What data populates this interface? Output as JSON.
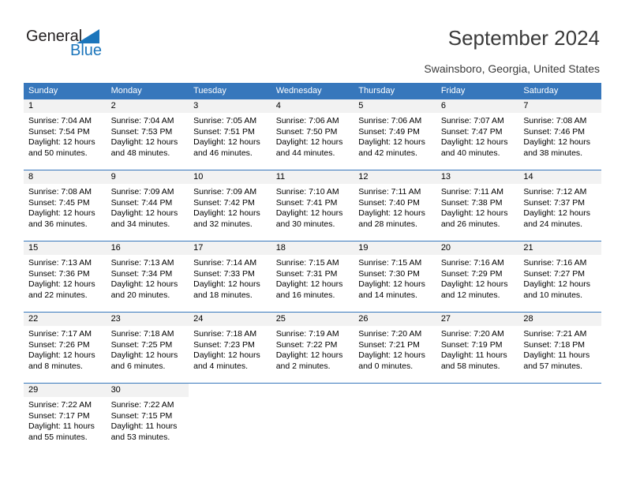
{
  "logo": {
    "text_top": "General",
    "text_bottom": "Blue",
    "triangle_color": "#1b75bb",
    "text_top_color": "#231f20",
    "text_bottom_color": "#1b75bb"
  },
  "header": {
    "title": "September 2024",
    "subtitle": "Swainsboro, Georgia, United States"
  },
  "theme": {
    "header_blue": "#3777bc",
    "day_band_gray": "#f2f2f2",
    "cell_white": "#ffffff",
    "text_dark": "#000000"
  },
  "calendar": {
    "weekday_headers": [
      "Sunday",
      "Monday",
      "Tuesday",
      "Wednesday",
      "Thursday",
      "Friday",
      "Saturday"
    ],
    "weeks": [
      [
        {
          "day": "1",
          "sunrise": "Sunrise: 7:04 AM",
          "sunset": "Sunset: 7:54 PM",
          "daylight_line1": "Daylight: 12 hours",
          "daylight_line2": "and 50 minutes."
        },
        {
          "day": "2",
          "sunrise": "Sunrise: 7:04 AM",
          "sunset": "Sunset: 7:53 PM",
          "daylight_line1": "Daylight: 12 hours",
          "daylight_line2": "and 48 minutes."
        },
        {
          "day": "3",
          "sunrise": "Sunrise: 7:05 AM",
          "sunset": "Sunset: 7:51 PM",
          "daylight_line1": "Daylight: 12 hours",
          "daylight_line2": "and 46 minutes."
        },
        {
          "day": "4",
          "sunrise": "Sunrise: 7:06 AM",
          "sunset": "Sunset: 7:50 PM",
          "daylight_line1": "Daylight: 12 hours",
          "daylight_line2": "and 44 minutes."
        },
        {
          "day": "5",
          "sunrise": "Sunrise: 7:06 AM",
          "sunset": "Sunset: 7:49 PM",
          "daylight_line1": "Daylight: 12 hours",
          "daylight_line2": "and 42 minutes."
        },
        {
          "day": "6",
          "sunrise": "Sunrise: 7:07 AM",
          "sunset": "Sunset: 7:47 PM",
          "daylight_line1": "Daylight: 12 hours",
          "daylight_line2": "and 40 minutes."
        },
        {
          "day": "7",
          "sunrise": "Sunrise: 7:08 AM",
          "sunset": "Sunset: 7:46 PM",
          "daylight_line1": "Daylight: 12 hours",
          "daylight_line2": "and 38 minutes."
        }
      ],
      [
        {
          "day": "8",
          "sunrise": "Sunrise: 7:08 AM",
          "sunset": "Sunset: 7:45 PM",
          "daylight_line1": "Daylight: 12 hours",
          "daylight_line2": "and 36 minutes."
        },
        {
          "day": "9",
          "sunrise": "Sunrise: 7:09 AM",
          "sunset": "Sunset: 7:44 PM",
          "daylight_line1": "Daylight: 12 hours",
          "daylight_line2": "and 34 minutes."
        },
        {
          "day": "10",
          "sunrise": "Sunrise: 7:09 AM",
          "sunset": "Sunset: 7:42 PM",
          "daylight_line1": "Daylight: 12 hours",
          "daylight_line2": "and 32 minutes."
        },
        {
          "day": "11",
          "sunrise": "Sunrise: 7:10 AM",
          "sunset": "Sunset: 7:41 PM",
          "daylight_line1": "Daylight: 12 hours",
          "daylight_line2": "and 30 minutes."
        },
        {
          "day": "12",
          "sunrise": "Sunrise: 7:11 AM",
          "sunset": "Sunset: 7:40 PM",
          "daylight_line1": "Daylight: 12 hours",
          "daylight_line2": "and 28 minutes."
        },
        {
          "day": "13",
          "sunrise": "Sunrise: 7:11 AM",
          "sunset": "Sunset: 7:38 PM",
          "daylight_line1": "Daylight: 12 hours",
          "daylight_line2": "and 26 minutes."
        },
        {
          "day": "14",
          "sunrise": "Sunrise: 7:12 AM",
          "sunset": "Sunset: 7:37 PM",
          "daylight_line1": "Daylight: 12 hours",
          "daylight_line2": "and 24 minutes."
        }
      ],
      [
        {
          "day": "15",
          "sunrise": "Sunrise: 7:13 AM",
          "sunset": "Sunset: 7:36 PM",
          "daylight_line1": "Daylight: 12 hours",
          "daylight_line2": "and 22 minutes."
        },
        {
          "day": "16",
          "sunrise": "Sunrise: 7:13 AM",
          "sunset": "Sunset: 7:34 PM",
          "daylight_line1": "Daylight: 12 hours",
          "daylight_line2": "and 20 minutes."
        },
        {
          "day": "17",
          "sunrise": "Sunrise: 7:14 AM",
          "sunset": "Sunset: 7:33 PM",
          "daylight_line1": "Daylight: 12 hours",
          "daylight_line2": "and 18 minutes."
        },
        {
          "day": "18",
          "sunrise": "Sunrise: 7:15 AM",
          "sunset": "Sunset: 7:31 PM",
          "daylight_line1": "Daylight: 12 hours",
          "daylight_line2": "and 16 minutes."
        },
        {
          "day": "19",
          "sunrise": "Sunrise: 7:15 AM",
          "sunset": "Sunset: 7:30 PM",
          "daylight_line1": "Daylight: 12 hours",
          "daylight_line2": "and 14 minutes."
        },
        {
          "day": "20",
          "sunrise": "Sunrise: 7:16 AM",
          "sunset": "Sunset: 7:29 PM",
          "daylight_line1": "Daylight: 12 hours",
          "daylight_line2": "and 12 minutes."
        },
        {
          "day": "21",
          "sunrise": "Sunrise: 7:16 AM",
          "sunset": "Sunset: 7:27 PM",
          "daylight_line1": "Daylight: 12 hours",
          "daylight_line2": "and 10 minutes."
        }
      ],
      [
        {
          "day": "22",
          "sunrise": "Sunrise: 7:17 AM",
          "sunset": "Sunset: 7:26 PM",
          "daylight_line1": "Daylight: 12 hours",
          "daylight_line2": "and 8 minutes."
        },
        {
          "day": "23",
          "sunrise": "Sunrise: 7:18 AM",
          "sunset": "Sunset: 7:25 PM",
          "daylight_line1": "Daylight: 12 hours",
          "daylight_line2": "and 6 minutes."
        },
        {
          "day": "24",
          "sunrise": "Sunrise: 7:18 AM",
          "sunset": "Sunset: 7:23 PM",
          "daylight_line1": "Daylight: 12 hours",
          "daylight_line2": "and 4 minutes."
        },
        {
          "day": "25",
          "sunrise": "Sunrise: 7:19 AM",
          "sunset": "Sunset: 7:22 PM",
          "daylight_line1": "Daylight: 12 hours",
          "daylight_line2": "and 2 minutes."
        },
        {
          "day": "26",
          "sunrise": "Sunrise: 7:20 AM",
          "sunset": "Sunset: 7:21 PM",
          "daylight_line1": "Daylight: 12 hours",
          "daylight_line2": "and 0 minutes."
        },
        {
          "day": "27",
          "sunrise": "Sunrise: 7:20 AM",
          "sunset": "Sunset: 7:19 PM",
          "daylight_line1": "Daylight: 11 hours",
          "daylight_line2": "and 58 minutes."
        },
        {
          "day": "28",
          "sunrise": "Sunrise: 7:21 AM",
          "sunset": "Sunset: 7:18 PM",
          "daylight_line1": "Daylight: 11 hours",
          "daylight_line2": "and 57 minutes."
        }
      ],
      [
        {
          "day": "29",
          "sunrise": "Sunrise: 7:22 AM",
          "sunset": "Sunset: 7:17 PM",
          "daylight_line1": "Daylight: 11 hours",
          "daylight_line2": "and 55 minutes."
        },
        {
          "day": "30",
          "sunrise": "Sunrise: 7:22 AM",
          "sunset": "Sunset: 7:15 PM",
          "daylight_line1": "Daylight: 11 hours",
          "daylight_line2": "and 53 minutes."
        },
        {
          "day": "",
          "sunrise": "",
          "sunset": "",
          "daylight_line1": "",
          "daylight_line2": ""
        },
        {
          "day": "",
          "sunrise": "",
          "sunset": "",
          "daylight_line1": "",
          "daylight_line2": ""
        },
        {
          "day": "",
          "sunrise": "",
          "sunset": "",
          "daylight_line1": "",
          "daylight_line2": ""
        },
        {
          "day": "",
          "sunrise": "",
          "sunset": "",
          "daylight_line1": "",
          "daylight_line2": ""
        },
        {
          "day": "",
          "sunrise": "",
          "sunset": "",
          "daylight_line1": "",
          "daylight_line2": ""
        }
      ]
    ]
  }
}
